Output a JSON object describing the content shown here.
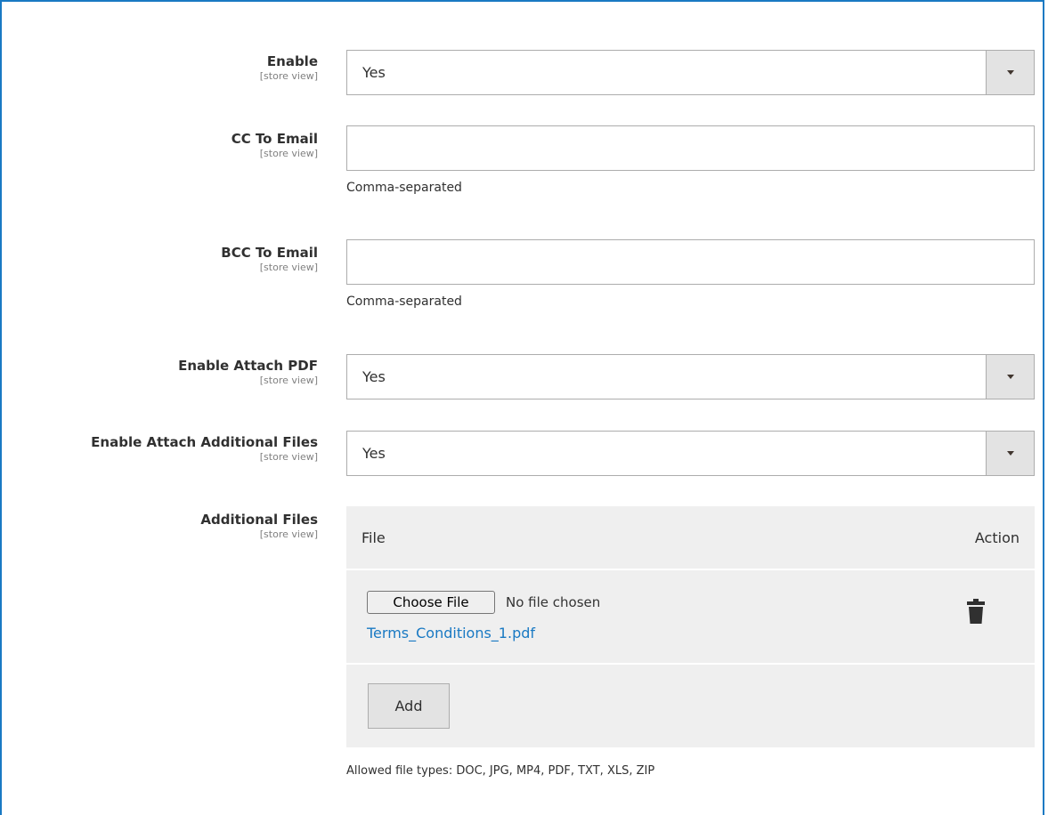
{
  "fields": {
    "enable": {
      "label": "Enable",
      "scope": "[store view]",
      "value": "Yes"
    },
    "cc_email": {
      "label": "CC To Email",
      "scope": "[store view]",
      "value": "",
      "note": "Comma-separated"
    },
    "bcc_email": {
      "label": "BCC To Email",
      "scope": "[store view]",
      "value": "",
      "note": "Comma-separated"
    },
    "attach_pdf": {
      "label": "Enable Attach PDF",
      "scope": "[store view]",
      "value": "Yes"
    },
    "attach_files": {
      "label": "Enable Attach Additional Files",
      "scope": "[store view]",
      "value": "Yes"
    },
    "additional_files": {
      "label": "Additional Files",
      "scope": "[store view]",
      "columns": {
        "file": "File",
        "action": "Action"
      },
      "rows": [
        {
          "choose_label": "Choose File",
          "chosen_text": "No file chosen",
          "filename": "Terms_Conditions_1.pdf",
          "action_icon": "trash-icon"
        }
      ],
      "add_label": "Add",
      "note": "Allowed file types: DOC, JPG, MP4, PDF, TXT, XLS, ZIP"
    }
  },
  "colors": {
    "accent": "#1979c3",
    "table_bg": "#efefef",
    "select_button_bg": "#e3e3e3"
  }
}
